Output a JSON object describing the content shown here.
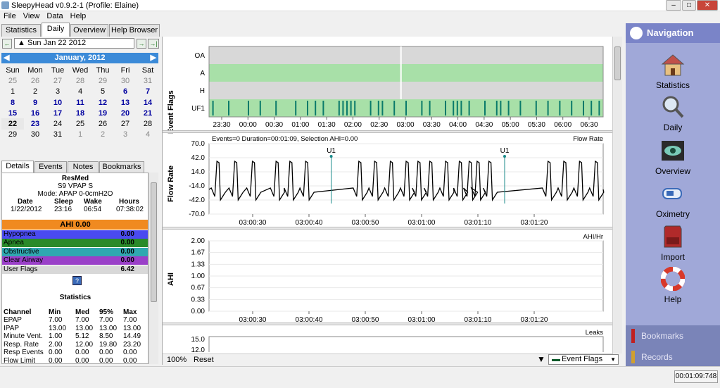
{
  "window": {
    "title": "SleepyHead v0.9.2-1  (Profile: Elaine)",
    "min": "–",
    "max": "□",
    "close": "✕"
  },
  "menu": [
    "File",
    "View",
    "Data",
    "Help"
  ],
  "tabs": [
    "Statistics",
    "Daily",
    "Overview",
    "Help Browser"
  ],
  "date_selector": {
    "value": "Sun Jan 22 2012",
    "prev": "←",
    "next": "→",
    "last": "→|"
  },
  "calendar": {
    "month": "January,  2012",
    "prev": "◀",
    "next": "▶",
    "weekdays": [
      "Sun",
      "Mon",
      "Tue",
      "Wed",
      "Thu",
      "Fri",
      "Sat"
    ],
    "rows": [
      [
        "25",
        "26",
        "27",
        "28",
        "29",
        "30",
        "31"
      ],
      [
        "1",
        "2",
        "3",
        "4",
        "5",
        "6",
        "7"
      ],
      [
        "8",
        "9",
        "10",
        "11",
        "12",
        "13",
        "14"
      ],
      [
        "15",
        "16",
        "17",
        "18",
        "19",
        "20",
        "21"
      ],
      [
        "22",
        "23",
        "24",
        "25",
        "26",
        "27",
        "28"
      ],
      [
        "29",
        "30",
        "31",
        "1",
        "2",
        "3",
        "4"
      ]
    ]
  },
  "detail_tabs": [
    "Details",
    "Events",
    "Notes",
    "Bookmarks"
  ],
  "details": {
    "machine": "ResMed",
    "model": "S9 VPAP S",
    "mode": "Mode: APAP 0-0cmH2O",
    "headers": [
      "Date",
      "Sleep",
      "Wake",
      "Hours"
    ],
    "values": [
      "1/22/2012",
      "23:16",
      "06:54",
      "07:38:02"
    ],
    "ahi": "AHI 0.00",
    "indices": [
      {
        "label": "Hypopnea",
        "value": "0.00",
        "color": "#4a4af0"
      },
      {
        "label": "Apnea",
        "value": "0.00",
        "color": "#2a8a2a"
      },
      {
        "label": "Obstructive",
        "value": "0.00",
        "color": "#30a8b0"
      },
      {
        "label": "Clear Airway",
        "value": "0.00",
        "color": "#9a40c8"
      },
      {
        "label": "User Flags",
        "value": "6.42",
        "color": "#d8d8d8"
      }
    ],
    "help_icon": "?",
    "stats_title": "Statistics",
    "stats_headers": [
      "Channel",
      "Min",
      "Med",
      "95%",
      "Max"
    ],
    "stats_rows": [
      [
        "EPAP",
        "7.00",
        "7.00",
        "7.00",
        "7.00"
      ],
      [
        "IPAP",
        "13.00",
        "13.00",
        "13.00",
        "13.00"
      ],
      [
        "Minute Vent.",
        "1.00",
        "5.12",
        "8.50",
        "14.49"
      ],
      [
        "Resp. Rate",
        "2.00",
        "12.00",
        "19.80",
        "23.20"
      ],
      [
        "Resp Events",
        "0.00",
        "0.00",
        "0.00",
        "0.00"
      ],
      [
        "Flow Limit",
        "0.00",
        "0.00",
        "0.00",
        "0.00"
      ]
    ]
  },
  "event_flags": {
    "ylabel": "Event Flags",
    "rows": [
      "OA",
      "A",
      "H",
      "UF1"
    ],
    "times": [
      "23:30",
      "00:00",
      "00:30",
      "01:00",
      "01:30",
      "02:00",
      "02:30",
      "03:00",
      "03:30",
      "04:00",
      "04:30",
      "05:00",
      "05:30",
      "06:00",
      "06:30"
    ],
    "uf1_events_frac": [
      0.01,
      0.05,
      0.1,
      0.13,
      0.17,
      0.22,
      0.25,
      0.27,
      0.29,
      0.33,
      0.34,
      0.35,
      0.36,
      0.37,
      0.41,
      0.43,
      0.44,
      0.47,
      0.5,
      0.54,
      0.56,
      0.6,
      0.62,
      0.63,
      0.64,
      0.66,
      0.7,
      0.73,
      0.74,
      0.76,
      0.79,
      0.83,
      0.86,
      0.89,
      0.92,
      0.95,
      0.97,
      0.99
    ],
    "cursor_frac": 0.487
  },
  "flow_rate": {
    "ylabel": "Flow Rate",
    "info": "Events=0 Duration=00:01:09, Selection AHI=0.00",
    "title": "Flow Rate",
    "yticks": [
      "70.0",
      "42.0",
      "14.0",
      "-14.0",
      "-42.0",
      "-70.0"
    ],
    "xticks": [
      "03:00:30",
      "03:00:40",
      "03:00:50",
      "03:01:00",
      "03:01:10",
      "03:01:20"
    ],
    "markers": [
      {
        "label": "U1",
        "frac": 0.31
      },
      {
        "label": "U1",
        "frac": 0.75
      }
    ]
  },
  "ahi_chart": {
    "ylabel": "AHI",
    "title": "AHI/Hr",
    "yticks": [
      "2.00",
      "1.67",
      "1.33",
      "1.00",
      "0.67",
      "0.33",
      "0.00"
    ],
    "xticks": [
      "03:00:30",
      "03:00:40",
      "03:00:50",
      "03:01:00",
      "03:01:10",
      "03:01:20"
    ]
  },
  "leaks_chart": {
    "title": "Leaks",
    "yticks": [
      "15.0",
      "12.0"
    ]
  },
  "bottom_bar": {
    "zoom": "100%",
    "reset": "Reset",
    "dropdown": "Event Flags"
  },
  "sidebar": {
    "title": "Navigation",
    "items": [
      {
        "label": "Statistics",
        "icon": "house-icon"
      },
      {
        "label": "Daily",
        "icon": "magnifier-icon"
      },
      {
        "label": "Overview",
        "icon": "eye-icon"
      },
      {
        "label": "Oximetry",
        "icon": "oximeter-icon"
      },
      {
        "label": "Import",
        "icon": "sdcard-icon"
      },
      {
        "label": "Help",
        "icon": "lifebuoy-icon"
      }
    ],
    "footer": [
      "Bookmarks",
      "Records"
    ]
  },
  "status": {
    "time": "00:01:09:748"
  },
  "colors": {
    "ahi_bar": "#f08a20",
    "uf1_band": "#a8e0a8",
    "event_tick": "#0a7a6a"
  }
}
